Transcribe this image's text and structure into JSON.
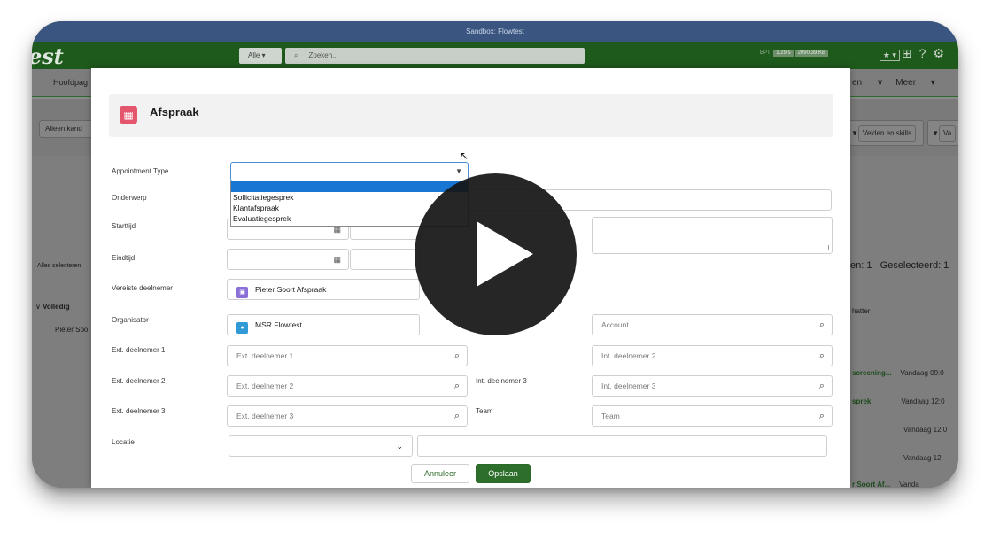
{
  "window": {
    "title": "Sandbox: Flowtest"
  },
  "appbar": {
    "logo": "est",
    "scope": "Alle",
    "search_placeholder": "Zoeken...",
    "stats": {
      "ept_label": "EPT",
      "ept": "1.29 s",
      "size": "2090.39 KB"
    },
    "icons": [
      "star-icon",
      "plus-icon",
      "help-icon",
      "gear-icon"
    ]
  },
  "nav": {
    "left_item": "Hoofdpag",
    "right_items": [
      "en",
      "Meer"
    ]
  },
  "subbar": {
    "left_chip": "Alleen kand",
    "right_chips": [
      "Velden en skills",
      "Va"
    ]
  },
  "background": {
    "select_all": "Alles selecteren",
    "col_header": "Volledig",
    "row_name": "Pieter Soo",
    "count_text": "en: 1",
    "selected_text": "Geselecteerd: 1",
    "col_right": "hatter",
    "rows": [
      {
        "name": "screening...",
        "time": "Vandaag 09:0"
      },
      {
        "name": "sprek",
        "time": "Vandaag 12:0"
      },
      {
        "name": "",
        "time": "Vandaag 12:0"
      },
      {
        "name": "",
        "time": "Vandaag 12:"
      },
      {
        "name": "r Soort Af...",
        "time": "Vanda"
      }
    ]
  },
  "modal": {
    "title": "Afspraak",
    "labels": {
      "appointment_type": "Appointment Type",
      "onderwerp": "Onderwerp",
      "starttijd": "Starttijd",
      "eindtijd": "Eindtijd",
      "vereiste": "Vereiste deelnemer",
      "organisator": "Organisator",
      "ext1": "Ext. deelnemer 1",
      "ext2": "Ext. deelnemer 2",
      "ext3": "Ext. deelnemer 3",
      "locatie": "Locatie",
      "int2": "r 2",
      "int3": "Int. deelnemer 3",
      "team": "Team"
    },
    "dropdown_options": [
      "Sollicitatiegesprek",
      "Klantafspraak",
      "Evaluatiegesprek"
    ],
    "values": {
      "vereiste": "Pieter Soort Afspraak",
      "organisator": "MSR Flowtest"
    },
    "placeholders": {
      "account": "Account",
      "ext1": "Ext. deelnemer 1",
      "ext2": "Ext. deelnemer 2",
      "ext3": "Ext. deelnemer 3",
      "int2": "Int. deelnemer 2",
      "int3": "Int. deelnemer 3",
      "team": "Team"
    },
    "buttons": {
      "cancel": "Annuleer",
      "save": "Opslaan"
    }
  }
}
